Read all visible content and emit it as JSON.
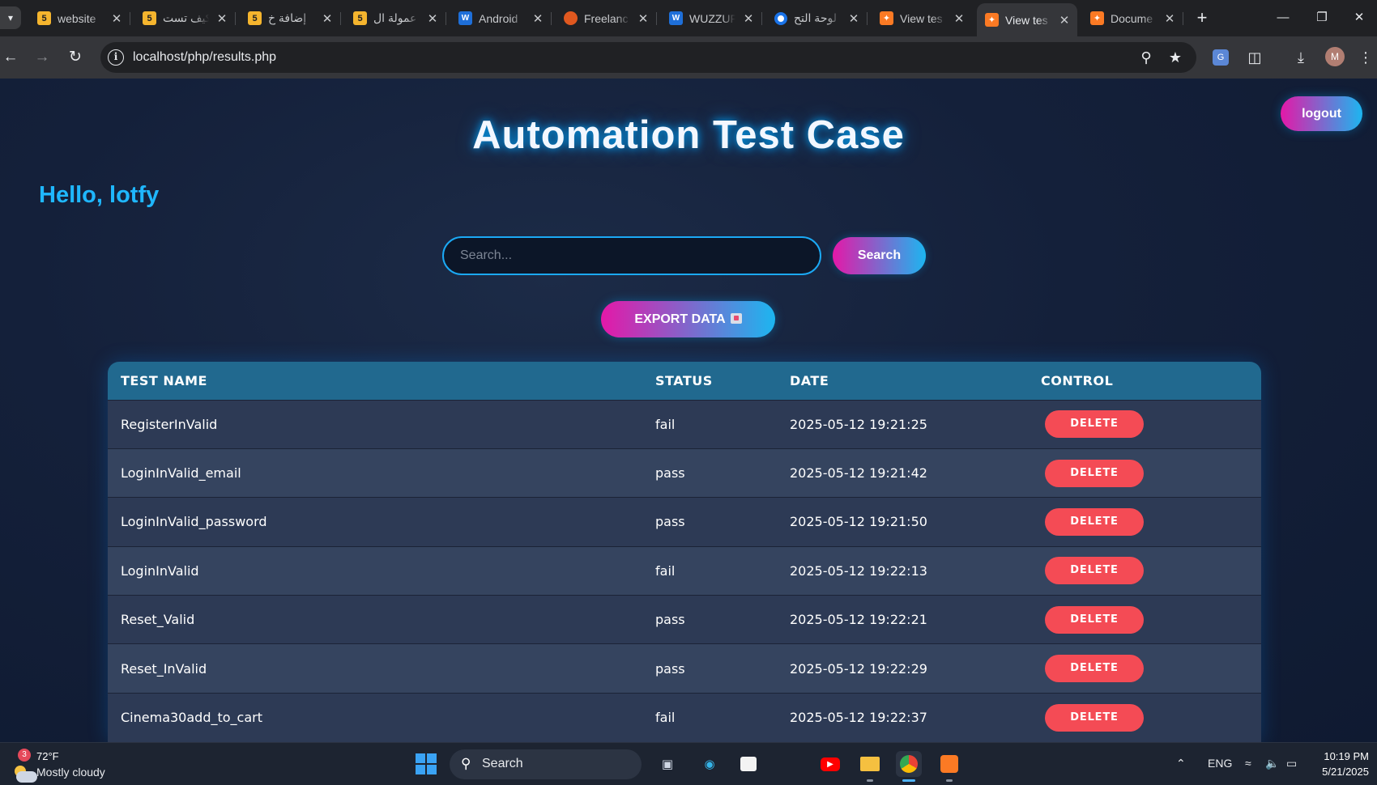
{
  "browser": {
    "tabs": [
      {
        "title": "website",
        "favicon": "five-icon"
      },
      {
        "title": "كيف تست",
        "favicon": "five-icon"
      },
      {
        "title": "إضافة خ",
        "favicon": "five-icon"
      },
      {
        "title": "عمولة ال",
        "favicon": "five-icon"
      },
      {
        "title": "Android",
        "favicon": "w-icon"
      },
      {
        "title": "Freelanc",
        "favicon": "fox-icon"
      },
      {
        "title": "WUZZUF",
        "favicon": "w-icon"
      },
      {
        "title": "لوحة التح",
        "favicon": "circle-icon"
      },
      {
        "title": "View tes",
        "favicon": "xampp-icon"
      },
      {
        "title": "View tes",
        "favicon": "xampp-icon",
        "active": true
      },
      {
        "title": "Docume",
        "favicon": "xampp-icon"
      }
    ],
    "url_host": "localhost",
    "url_path": "/php/results.php",
    "profile_initial": "M"
  },
  "page": {
    "title": "Automation Test Case",
    "greeting": "Hello, lotfy",
    "logout_label": "logout",
    "search_placeholder": "Search...",
    "search_label": "Search",
    "export_label": "EXPORT DATA",
    "table": {
      "headers": [
        "TEST NAME",
        "STATUS",
        "DATE",
        "CONTROL"
      ],
      "delete_label": "DELETE",
      "rows": [
        {
          "name": "RegisterInValid",
          "status": "fail",
          "date": "2025-05-12 19:21:25"
        },
        {
          "name": "LoginInValid_email",
          "status": "pass",
          "date": "2025-05-12 19:21:42"
        },
        {
          "name": "LoginInValid_password",
          "status": "pass",
          "date": "2025-05-12 19:21:50"
        },
        {
          "name": "LoginInValid",
          "status": "fail",
          "date": "2025-05-12 19:22:13"
        },
        {
          "name": "Reset_Valid",
          "status": "pass",
          "date": "2025-05-12 19:22:21"
        },
        {
          "name": "Reset_InValid",
          "status": "pass",
          "date": "2025-05-12 19:22:29"
        },
        {
          "name": "Cinema30add_to_cart",
          "status": "fail",
          "date": "2025-05-12 19:22:37"
        }
      ]
    },
    "colors": {
      "accent_start": "#e418a8",
      "accent_end": "#1cb6f0",
      "delete": "#f44b55",
      "header": "#21698f"
    }
  },
  "taskbar": {
    "weather_badge": "3",
    "weather_temp": "72°F",
    "weather_desc": "Mostly cloudy",
    "search_label": "Search",
    "language": "ENG",
    "time": "10:19 PM",
    "date": "5/21/2025"
  }
}
